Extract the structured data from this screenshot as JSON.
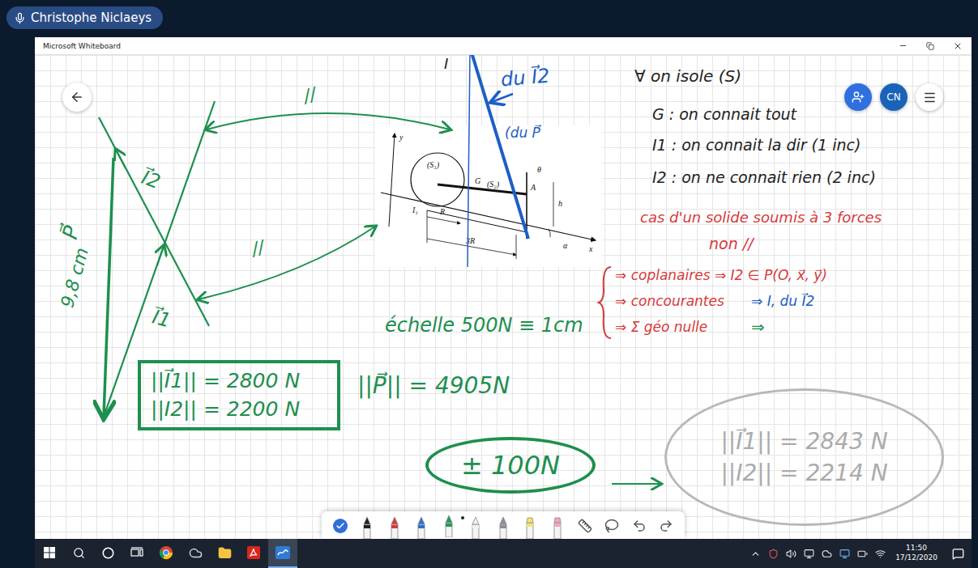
{
  "presenter": {
    "name": "Christophe Niclaeys",
    "mic_on": true
  },
  "window": {
    "title": "Microsoft Whiteboard"
  },
  "board": {
    "avatar": {
      "initials": "CN"
    },
    "notes": [
      {
        "text": "I",
        "color": "#222222"
      },
      {
        "text": "du I⃗2",
        "color": "#1d5fc4"
      },
      {
        "text": "(du P⃗",
        "color": "#1d5fc4"
      },
      {
        "text": "//",
        "color": "#1e8f4e"
      },
      {
        "text": "//",
        "color": "#1e8f4e"
      },
      {
        "text": "I⃗2",
        "color": "#1e8f4e"
      },
      {
        "text": "P⃗",
        "color": "#1e8f4e"
      },
      {
        "text": "9,8 cm",
        "color": "#1e8f4e"
      },
      {
        "text": "I⃗1",
        "color": "#1e8f4e"
      },
      {
        "text": "∀ on isole (S)",
        "color": "#222222"
      },
      {
        "text": "G : on connait tout",
        "color": "#222222"
      },
      {
        "text": "I1 : on connait la dir (1 inc)",
        "color": "#222222"
      },
      {
        "text": "I2 : on ne connait rien (2 inc)",
        "color": "#222222"
      },
      {
        "text": "cas d'un solide soumis à 3 forces",
        "color": "#d63a3a"
      },
      {
        "text": "non //",
        "color": "#d63a3a"
      },
      {
        "text": "⇒ coplanaires ⇒ I2 ∈ P(O, x⃗, y⃗)",
        "color": "#d63a3a"
      },
      {
        "text": "⇒ concourantes",
        "color": "#d63a3a"
      },
      {
        "text": "⇒ I, du I⃗2",
        "color": "#1d5fc4"
      },
      {
        "text": "⇒ Σ géo nulle",
        "color": "#d63a3a"
      },
      {
        "text": "⇒",
        "color": "#1e8f4e"
      },
      {
        "text": "échelle 500N ≡ 1cm",
        "color": "#1e8f4e"
      },
      {
        "text": "||P⃗|| = 4905N",
        "color": "#1e8f4e"
      }
    ],
    "figure": {
      "labels": [
        "y⃗",
        "(S₁)",
        "G",
        "(S₂)",
        "A",
        "θ",
        "h",
        "I₁",
        "R",
        "3R",
        "α",
        "x⃗"
      ]
    },
    "result_box": {
      "lines": [
        "||I⃗1|| = 2800 N",
        "||I2|| = 2200 N"
      ]
    },
    "tolerance": {
      "text": "± 100N"
    },
    "computed": {
      "lines": [
        "||I⃗1|| = 2843 N",
        "||I2|| = 2214 N"
      ]
    }
  },
  "pen_toolbar": {
    "tools": [
      {
        "kind": "check",
        "color": "#2f6fd6",
        "selected": false
      },
      {
        "kind": "pen",
        "color": "#222222",
        "selected": false
      },
      {
        "kind": "pen",
        "color": "#d83b3b",
        "selected": false
      },
      {
        "kind": "pen",
        "color": "#2f6fd6",
        "selected": false
      },
      {
        "kind": "pen",
        "color": "#1f9d55",
        "selected": true
      },
      {
        "kind": "pen",
        "color": "#f2f2f2",
        "selected": false
      },
      {
        "kind": "pen",
        "color": "#8a8f99",
        "selected": false
      },
      {
        "kind": "highlighter",
        "color": "#f7e26b",
        "selected": false
      },
      {
        "kind": "highlighter",
        "color": "#f4a3c4",
        "selected": false
      },
      {
        "kind": "ruler",
        "color": "#555555",
        "selected": false
      },
      {
        "kind": "lasso",
        "color": "#555555",
        "selected": false
      },
      {
        "kind": "undo",
        "color": "#555555",
        "selected": false
      },
      {
        "kind": "redo",
        "color": "#555555",
        "selected": false
      }
    ]
  },
  "taskbar": {
    "apps": [
      {
        "kind": "start",
        "selected": false
      },
      {
        "kind": "search",
        "selected": false
      },
      {
        "kind": "cortana",
        "selected": false
      },
      {
        "kind": "taskview",
        "selected": false
      },
      {
        "kind": "chrome",
        "selected": false
      },
      {
        "kind": "cloud",
        "selected": false
      },
      {
        "kind": "explorer",
        "selected": false
      },
      {
        "kind": "acrobat",
        "selected": false
      },
      {
        "kind": "whiteboard",
        "selected": true
      }
    ],
    "clock": {
      "time": "11:50",
      "date": "17/12/2020"
    }
  }
}
